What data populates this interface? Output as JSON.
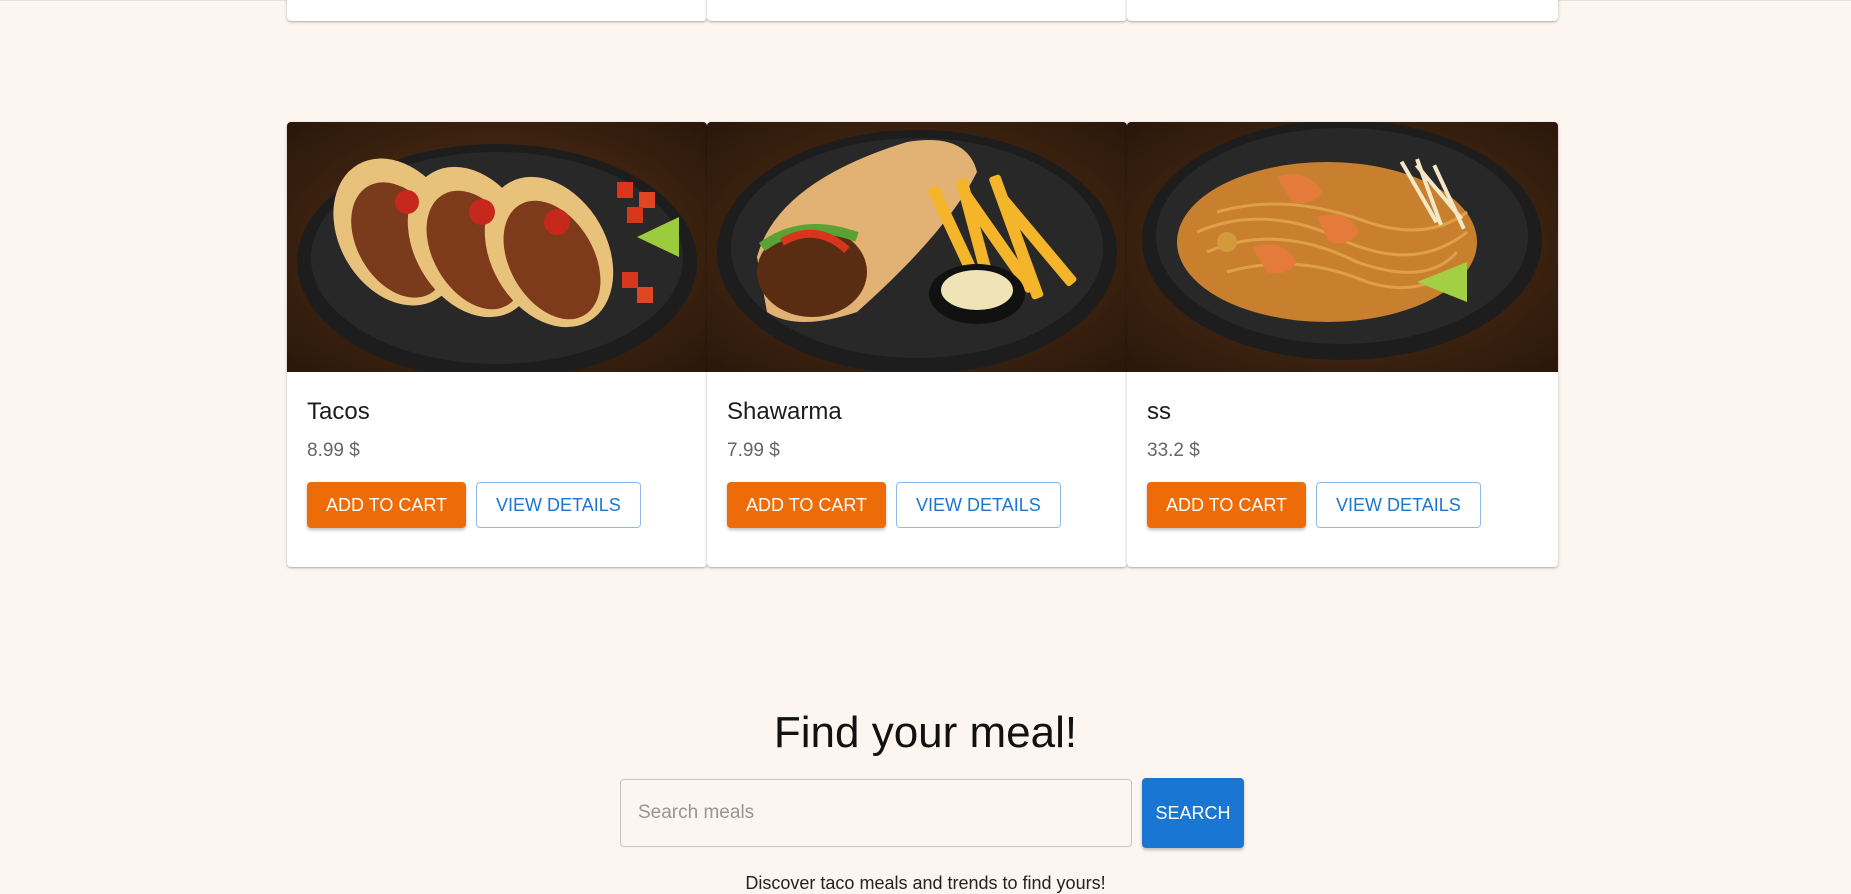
{
  "prev_cards_count": 3,
  "meals": [
    {
      "name": "Tacos",
      "price": "8.99 $",
      "image": "tacos-image"
    },
    {
      "name": "Shawarma",
      "price": "7.99 $",
      "image": "shawarma-image"
    },
    {
      "name": "ss",
      "price": "33.2 $",
      "image": "pad-thai-image"
    }
  ],
  "labels": {
    "add_to_cart": "ADD TO CART",
    "view_details": "VIEW DETAILS"
  },
  "search": {
    "title": "Find your meal!",
    "placeholder": "Search meals",
    "button": "SEARCH",
    "hint": "Discover taco meals and trends to find yours!"
  },
  "colors": {
    "page_background": "#fdf6f0",
    "primary_orange": "#ee6c07",
    "primary_blue": "#1976d2"
  }
}
